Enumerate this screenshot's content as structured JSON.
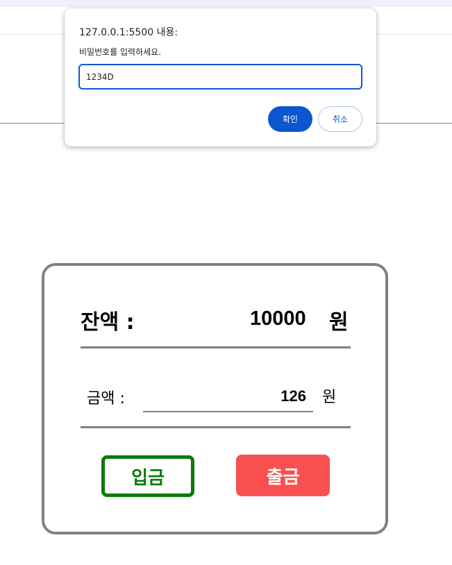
{
  "dialog": {
    "origin_title": "127.0.0.1:5500 내용:",
    "message": "비밀번호를 입력하세요.",
    "input_value": "1234D",
    "confirm_label": "확인",
    "cancel_label": "취소",
    "accent_color": "#0b57d0"
  },
  "account": {
    "balance_label": "잔액 :",
    "balance_value": "10000",
    "balance_unit": "원",
    "amount_label": "금액 :",
    "amount_value": "126",
    "amount_unit": "원",
    "deposit_label": "입금",
    "withdraw_label": "출금",
    "deposit_color": "#0a7a0a",
    "withdraw_color": "#f85050"
  }
}
